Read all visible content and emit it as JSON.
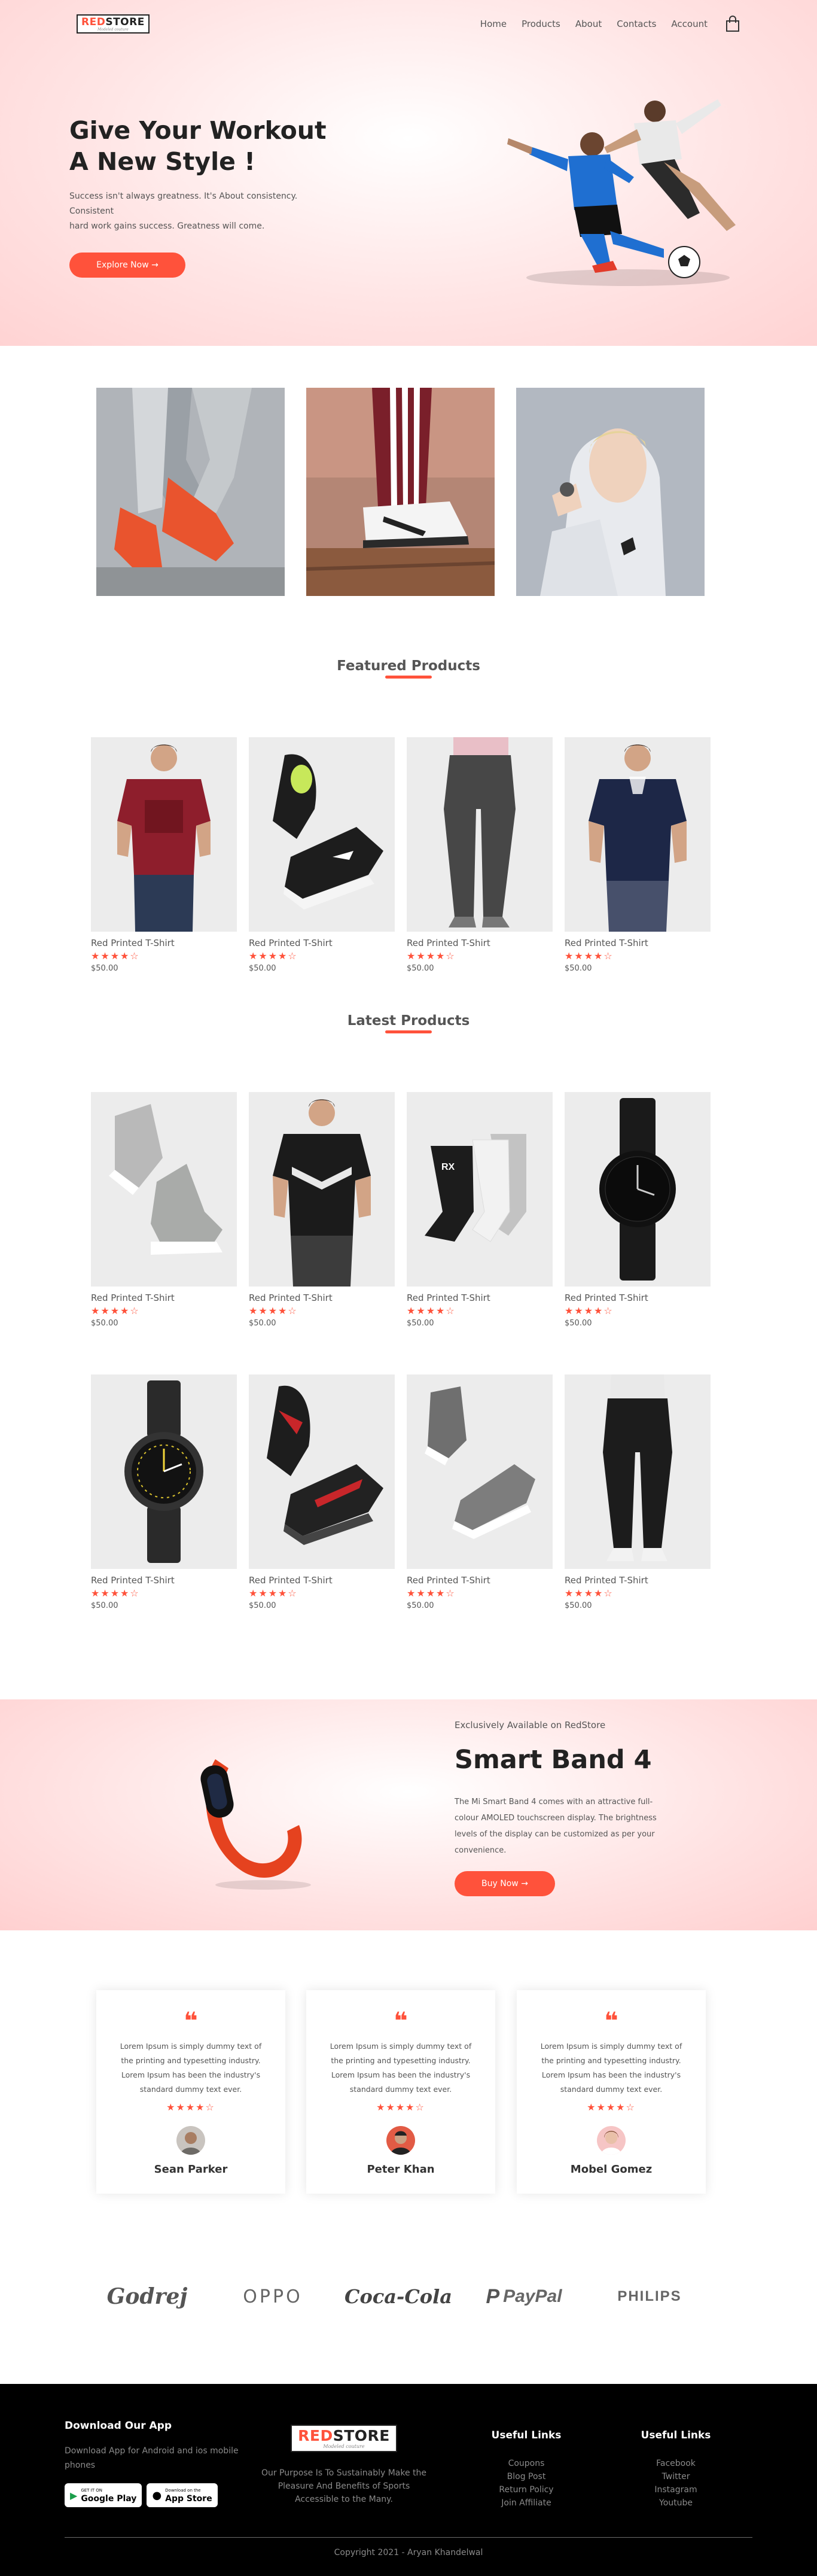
{
  "header": {
    "logo": {
      "red": "RED",
      "dark": "STORE",
      "tagline": "Modeled couture"
    },
    "nav": [
      "Home",
      "Products",
      "About",
      "Contacts",
      "Account"
    ],
    "cart_icon": "shopping-bag-icon"
  },
  "hero": {
    "title_line1": "Give Your Workout",
    "title_line2": "A New Style !",
    "description_line1": "Success isn't always greatness. It's About consistency. Consistent",
    "description_line2": "hard work gains success. Greatness will come.",
    "button": "Explore Now →"
  },
  "featured": {
    "title": "Featured Products",
    "products": [
      {
        "name": "Red Printed T-Shirt",
        "rating": 4,
        "stars": "★★★★☆",
        "price": "$50.00"
      },
      {
        "name": "Red Printed T-Shirt",
        "rating": 4,
        "stars": "★★★★☆",
        "price": "$50.00"
      },
      {
        "name": "Red Printed T-Shirt",
        "rating": 4,
        "stars": "★★★★☆",
        "price": "$50.00"
      },
      {
        "name": "Red Printed T-Shirt",
        "rating": 4,
        "stars": "★★★★☆",
        "price": "$50.00"
      }
    ]
  },
  "latest": {
    "title": "Latest Products",
    "products": [
      {
        "name": "Red Printed T-Shirt",
        "rating": 4,
        "stars": "★★★★☆",
        "price": "$50.00"
      },
      {
        "name": "Red Printed T-Shirt",
        "rating": 4,
        "stars": "★★★★☆",
        "price": "$50.00"
      },
      {
        "name": "Red Printed T-Shirt",
        "rating": 4,
        "stars": "★★★★☆",
        "price": "$50.00"
      },
      {
        "name": "Red Printed T-Shirt",
        "rating": 4,
        "stars": "★★★★☆",
        "price": "$50.00"
      },
      {
        "name": "Red Printed T-Shirt",
        "rating": 4,
        "stars": "★★★★☆",
        "price": "$50.00"
      },
      {
        "name": "Red Printed T-Shirt",
        "rating": 4,
        "stars": "★★★★☆",
        "price": "$50.00"
      },
      {
        "name": "Red Printed T-Shirt",
        "rating": 4,
        "stars": "★★★★☆",
        "price": "$50.00"
      },
      {
        "name": "Red Printed T-Shirt",
        "rating": 4,
        "stars": "★★★★☆",
        "price": "$50.00"
      }
    ]
  },
  "offer": {
    "eyebrow": "Exclusively Available on RedStore",
    "title": "Smart Band 4",
    "description": "The Mi Smart Band 4 comes with an attractive full-colour AMOLED touchscreen display. The brightness levels of the display can be customized as per your convenience.",
    "button": "Buy Now →"
  },
  "testimonials": [
    {
      "text": "Lorem Ipsum is simply dummy text of the printing and typesetting industry. Lorem Ipsum has been the industry's standard dummy text ever.",
      "stars": "★★★★☆",
      "name": "Sean Parker"
    },
    {
      "text": "Lorem Ipsum is simply dummy text of the printing and typesetting industry. Lorem Ipsum has been the industry's standard dummy text ever.",
      "stars": "★★★★☆",
      "name": "Peter Khan"
    },
    {
      "text": "Lorem Ipsum is simply dummy text of the printing and typesetting industry. Lorem Ipsum has been the industry's standard dummy text ever.",
      "stars": "★★★★☆",
      "name": "Mobel Gomez"
    }
  ],
  "brands": [
    "Godrej",
    "OPPO",
    "Coca-Cola",
    "PayPal",
    "PHILIPS"
  ],
  "footer": {
    "download_title": "Download Our App",
    "download_text": "Download App for Android and ios mobile phones",
    "google_play": {
      "small": "GET IT ON",
      "big": "Google Play"
    },
    "app_store": {
      "small": "Download on the",
      "big": "App Store"
    },
    "purpose": "Our Purpose Is To Sustainably Make the Pleasure And Benefits of Sports Accessible to the Many.",
    "useful_title_1": "Useful Links",
    "useful_links_1": [
      "Coupons",
      "Blog Post",
      "Return Policy",
      "Join Affiliate"
    ],
    "useful_title_2": "Useful Links",
    "useful_links_2": [
      "Facebook",
      "Twitter",
      "Instagram",
      "Youtube"
    ],
    "copyright": "Copyright 2021 - Aryan Khandelwal"
  },
  "colors": {
    "accent": "#ff523b",
    "dark": "#222222",
    "footer_bg": "#000000"
  }
}
